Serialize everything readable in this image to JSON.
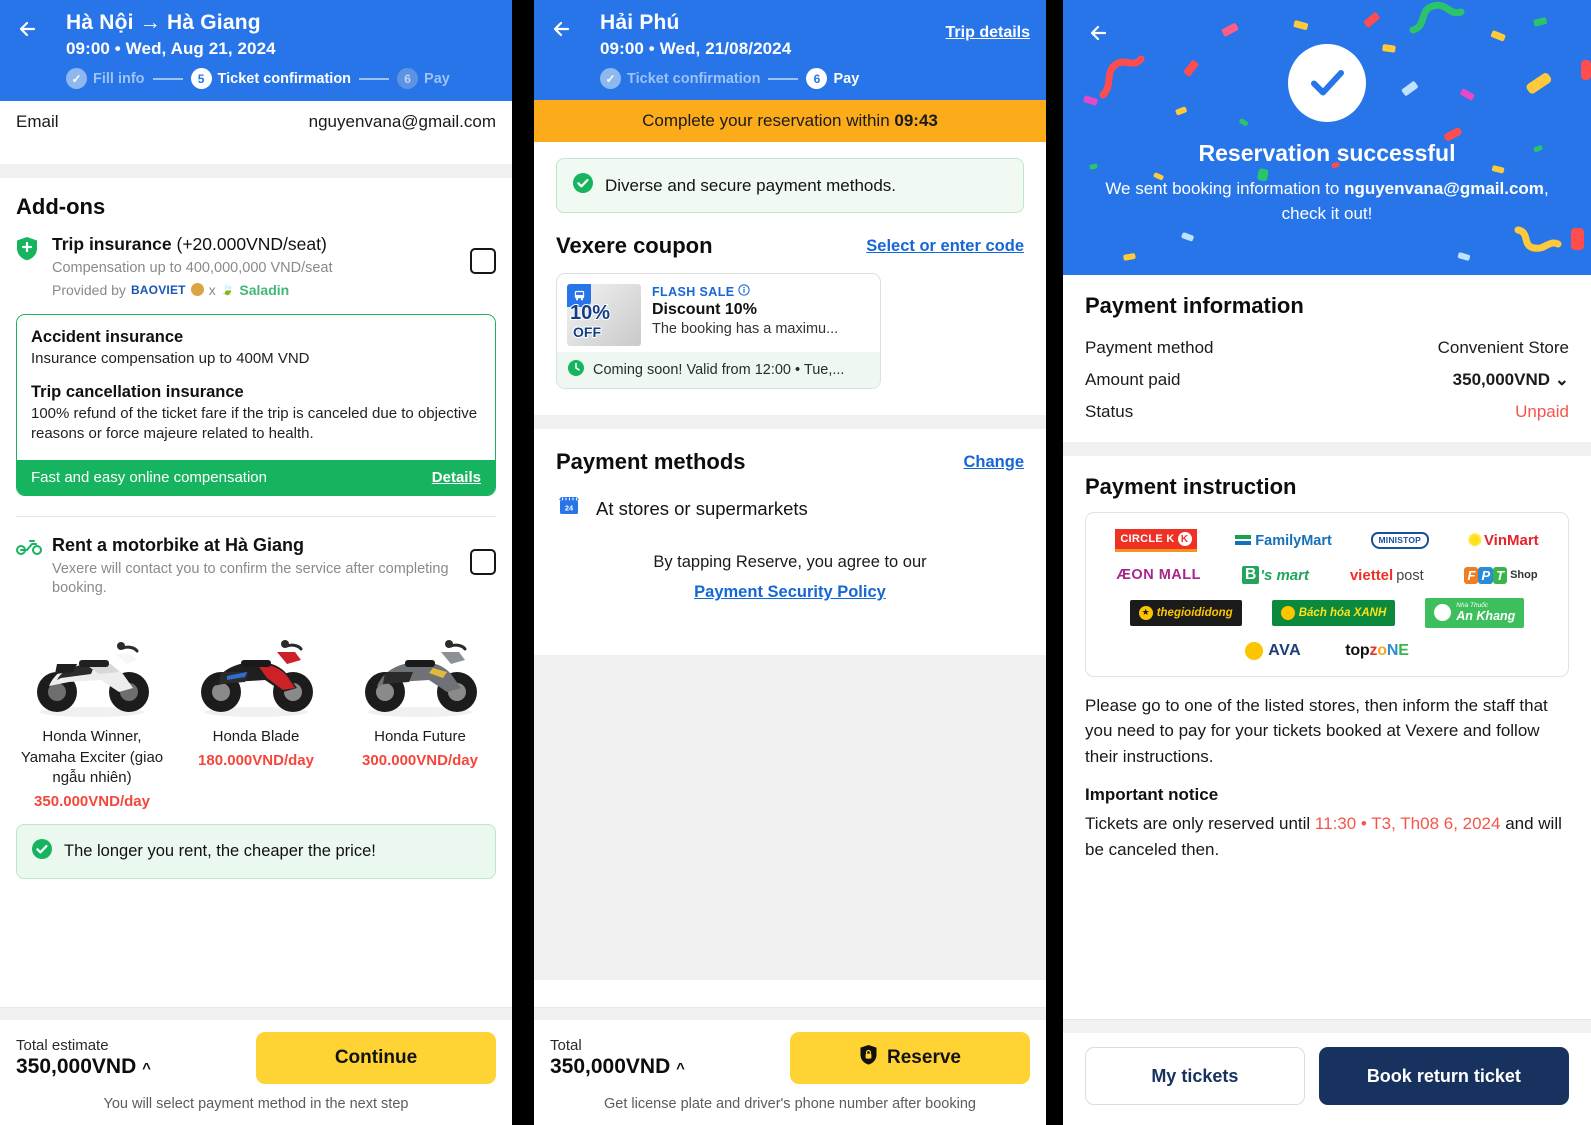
{
  "panel1": {
    "header": {
      "back_icon": "back-arrow-icon",
      "title": "Hà Nội → Hà Giang",
      "subtitle": "09:00 • Wed, Aug 21, 2024",
      "steps": [
        {
          "label": "Fill info",
          "badge": "✓",
          "state": "done"
        },
        {
          "label": "Ticket confirmation",
          "badge": "5",
          "state": "current"
        },
        {
          "label": "Pay",
          "badge": "6",
          "state": "next"
        }
      ]
    },
    "email_row": {
      "label": "Email",
      "value": "nguyenvana@gmail.com"
    },
    "addons_title": "Add-ons",
    "trip_insurance": {
      "icon": "shield-icon",
      "title": "Trip insurance",
      "price_suffix": "(+20.000VND/seat)",
      "compensation": "Compensation up to 400,000,000 VND/seat",
      "provided_by_label": "Provided by",
      "provider_1": "BAOVIET",
      "provider_sep": "x",
      "provider_2": "Saladin",
      "checkbox_checked": false
    },
    "insurance_card": {
      "accident_title": "Accident insurance",
      "accident_desc": "Insurance compensation up to 400M VND",
      "cancel_title": "Trip cancellation insurance",
      "cancel_desc": "100% refund of the ticket fare if the trip is canceled due to objective reasons or force majeure related to health.",
      "footer_text": "Fast and easy online compensation",
      "footer_link": "Details"
    },
    "motorbike": {
      "icon": "motorbike-icon",
      "title": "Rent a motorbike at Hà Giang",
      "desc": "Vexere will contact you to confirm the service after completing booking.",
      "checkbox_checked": false,
      "items": [
        {
          "name": "Honda Winner, Yamaha Exciter (giao ngẫu nhiên)",
          "price": "350.000VND/day"
        },
        {
          "name": "Honda Blade",
          "price": "180.000VND/day"
        },
        {
          "name": "Honda Future",
          "price": "300.000VND/day"
        }
      ],
      "note": "The longer you rent, the cheaper the price!"
    },
    "footer": {
      "total_label": "Total estimate",
      "total_value": "350,000VND",
      "caret": "^",
      "button": "Continue",
      "note": "You will select payment method in the next step"
    }
  },
  "panel2": {
    "header": {
      "back_icon": "back-arrow-icon",
      "title": "Hải Phú",
      "subtitle": "09:00 • Wed, 21/08/2024",
      "trip_details": "Trip details",
      "steps": [
        {
          "label": "Ticket confirmation",
          "badge": "✓",
          "state": "done"
        },
        {
          "label": "Pay",
          "badge": "6",
          "state": "current"
        }
      ]
    },
    "timer_prefix": "Complete your reservation within ",
    "timer_value": "09:43",
    "secure_note": "Diverse and secure payment methods.",
    "coupon": {
      "title": "Vexere coupon",
      "link": "Select or enter code",
      "badge_pct": "10%",
      "badge_off": "OFF",
      "tag": "FLASH SALE",
      "info_icon": "info-icon",
      "name": "Discount 10%",
      "desc": "The booking has a maximu...",
      "footer": "Coming soon! Valid from 12:00 • Tue,...",
      "clock_icon": "clock-icon"
    },
    "payment_methods": {
      "title": "Payment methods",
      "change_link": "Change",
      "selected_icon": "store-icon",
      "selected": "At stores or supermarkets"
    },
    "agree_text": "By tapping Reserve, you agree to our",
    "agree_link": "Payment Security Policy",
    "footer": {
      "total_label": "Total",
      "total_value": "350,000VND",
      "caret": "^",
      "button": "Reserve",
      "button_icon": "lock-shield-icon",
      "note": "Get license plate and driver's phone number after booking"
    }
  },
  "panel3": {
    "header": {
      "back_icon": "back-arrow-icon",
      "check_icon": "check-circle-icon",
      "title": "Reservation successful",
      "sub_prefix": "We sent booking information to ",
      "sub_email": "nguyenvana@gmail.com",
      "sub_suffix": ", check it out!"
    },
    "payment_information": {
      "title": "Payment information",
      "rows": [
        {
          "label": "Payment method",
          "value": "Convenient Store",
          "style": "plain"
        },
        {
          "label": "Amount paid",
          "value": "350,000VND",
          "style": "bold",
          "caret": "⌄"
        },
        {
          "label": "Status",
          "value": "Unpaid",
          "style": "red"
        }
      ]
    },
    "payment_instruction": {
      "title": "Payment instruction",
      "store_rows": [
        [
          "CIRCLE K",
          "FamilyMart",
          "MINI STOP",
          "VinMart"
        ],
        [
          "ÆON MALL",
          "B's mart",
          "viettel post",
          "FPT Shop"
        ],
        [
          "thegioididong",
          "Bách hóa XANH",
          "An Khang"
        ],
        [
          "AVA",
          "topzone"
        ]
      ],
      "instruction": "Please go to one of the listed stores, then inform the staff that you need to pay for your tickets booked at Vexere and follow their instructions.",
      "notice_title": "Important notice",
      "notice_prefix": "Tickets are only reserved until ",
      "notice_time": "11:30 • T3, Th08 6, 2024",
      "notice_suffix": " and will be canceled then."
    },
    "footer": {
      "secondary_button": "My tickets",
      "primary_button": "Book return ticket"
    }
  },
  "colors": {
    "brand_blue": "#2775e8",
    "accent_yellow": "#ffd333",
    "green": "#17b45f",
    "red": "#f5554a",
    "navy": "#17325f",
    "amber": "#fcab1b"
  }
}
